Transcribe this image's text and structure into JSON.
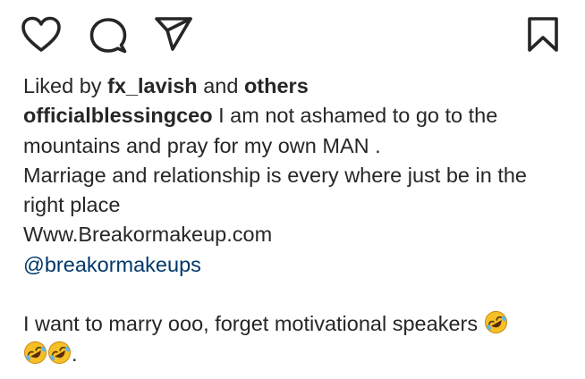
{
  "actions": {
    "like_icon": "heart-outline-icon",
    "comment_icon": "comment-bubble-icon",
    "share_icon": "paper-plane-icon",
    "save_icon": "bookmark-icon"
  },
  "likes": {
    "prefix": "Liked by",
    "user": "fx_lavish",
    "middle": "and",
    "others": "others"
  },
  "caption": {
    "username": "officialblessingceo",
    "line1": "I am not ashamed to go to the",
    "line2": "mountains and pray for my own MAN .",
    "line3": "Marriage and relationship is every where just be in the",
    "line4": "right place",
    "website": "Www.Breakormakeup.com",
    "mention": "@breakormakeups",
    "line5": "I want to marry ooo, forget motivational speakers",
    "line6_end": "."
  },
  "emoji": {
    "name": "rolling-on-the-floor-laughing-emoji",
    "color": "#f6c025"
  },
  "colors": {
    "text": "#262626",
    "link": "#00376b",
    "background": "#ffffff"
  }
}
